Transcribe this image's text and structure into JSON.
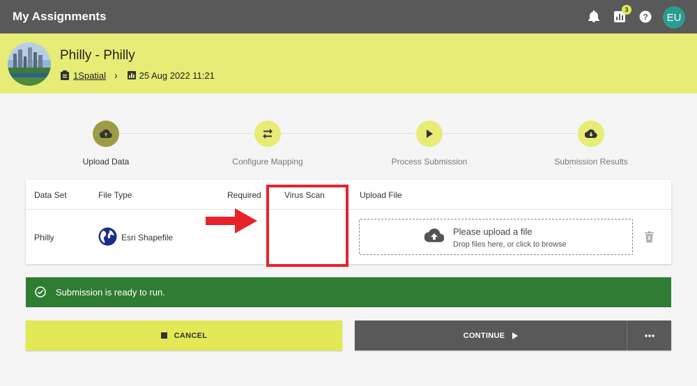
{
  "app": {
    "title": "My Assignments",
    "badge_count": "3",
    "avatar_initials": "EU"
  },
  "project": {
    "title": "Philly - Philly",
    "breadcrumb_link": "1Spatial",
    "timestamp": "25 Aug 2022 11:21"
  },
  "steps": [
    {
      "label": "Upload Data",
      "icon": "cloud-upload-icon",
      "active": true
    },
    {
      "label": "Configure Mapping",
      "icon": "swap-arrows-icon",
      "active": false
    },
    {
      "label": "Process Submission",
      "icon": "play-icon",
      "active": false
    },
    {
      "label": "Submission Results",
      "icon": "cloud-download-icon",
      "active": false
    }
  ],
  "table": {
    "headers": {
      "dataset": "Data Set",
      "filetype": "File Type",
      "required": "Required",
      "virus": "Virus Scan",
      "upload": "Upload File"
    },
    "rows": [
      {
        "dataset": "Philly",
        "filetype": "Esri Shapefile",
        "upload_main": "Please upload a file",
        "upload_sub": "Drop files here, or click to browse"
      }
    ]
  },
  "status": {
    "message": "Submission is ready to run."
  },
  "actions": {
    "cancel": "CANCEL",
    "continue": "CONTINUE"
  },
  "colors": {
    "topbar": "#595959",
    "header": "#e6ec75",
    "success": "#2e7d32",
    "highlight": "#e8222a",
    "avatar": "#2a9d8f"
  }
}
